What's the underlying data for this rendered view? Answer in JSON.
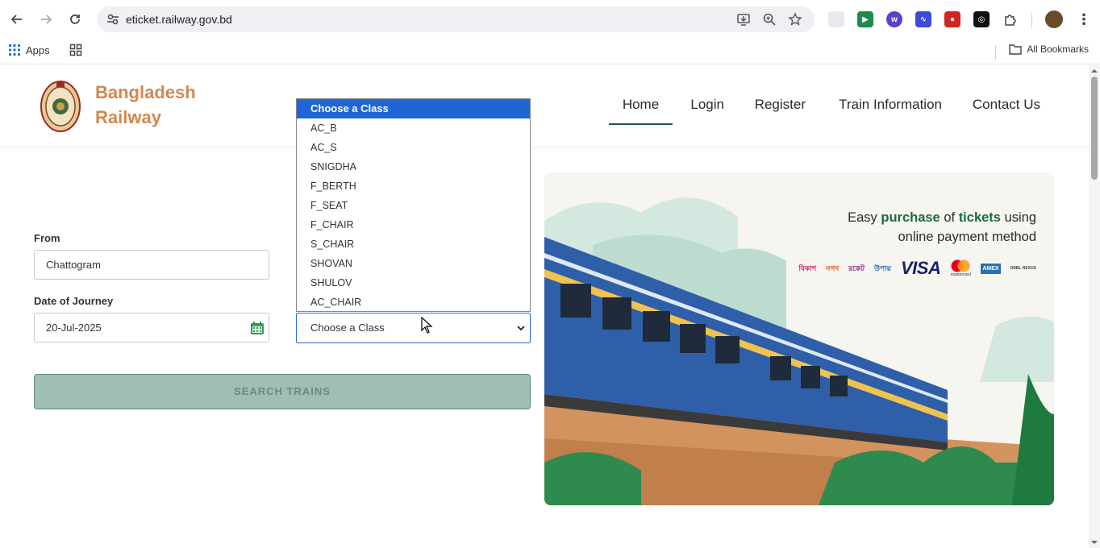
{
  "browser": {
    "url": "eticket.railway.gov.bd",
    "bookmarks": {
      "apps_label": "Apps",
      "all_bookmarks_label": "All Bookmarks"
    }
  },
  "site": {
    "brand_line1": "Bangladesh",
    "brand_line2": "Railway",
    "brand_color": "#d2874e",
    "accent_color": "#1a5c42",
    "nav": [
      "Home",
      "Login",
      "Register",
      "Train Information",
      "Contact Us"
    ],
    "active_nav": "Home"
  },
  "form": {
    "from_label": "From",
    "from_value": "Chattogram",
    "date_label": "Date of Journey",
    "date_value": "20-Jul-2025",
    "class_select_value": "Choose a Class",
    "class_options": [
      "Choose a Class",
      "AC_B",
      "AC_S",
      "SNIGDHA",
      "F_BERTH",
      "F_SEAT",
      "F_CHAIR",
      "S_CHAIR",
      "SHOVAN",
      "SHULOV",
      "AC_CHAIR"
    ],
    "selected_option": "Choose a Class",
    "search_button": "SEARCH TRAINS"
  },
  "banner": {
    "text_part1": "Easy ",
    "text_hl1": "purchase",
    "text_part2": " of ",
    "text_hl2": "tickets",
    "text_part3": " using",
    "text_line2": "online payment method",
    "payments": [
      "বিকাশ",
      "নগদ",
      "রকেট",
      "উপায়",
      "VISA",
      "mastercard",
      "AMEX",
      "DBBL NEXUS"
    ]
  }
}
